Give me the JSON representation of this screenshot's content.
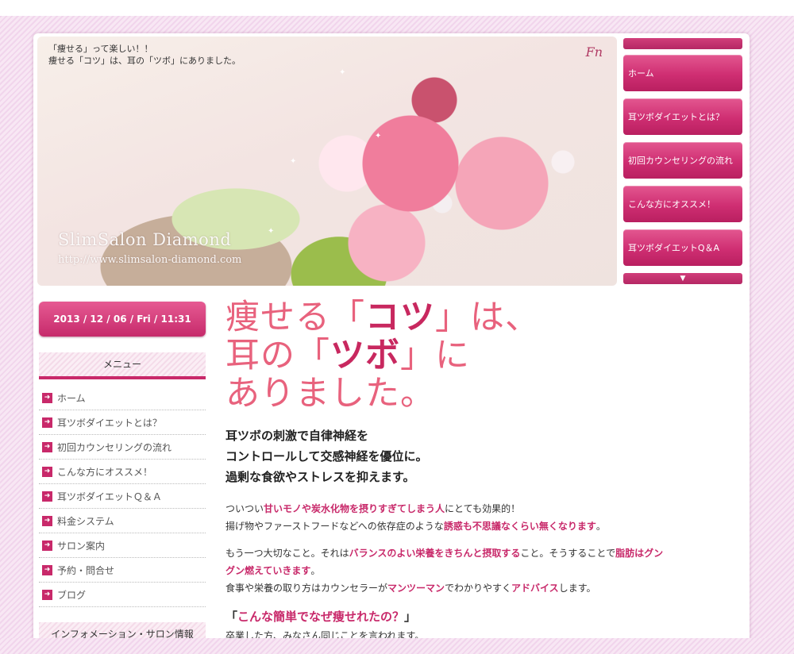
{
  "header": {
    "caption_line1": "「痩せる」って楽しい！！",
    "caption_line2": "痩せる「コツ」は、耳の「ツボ」にありました。",
    "logo_text": "Fn",
    "site_name": "SlimSalon Diamond",
    "site_url": "http://www.slimsalon-diamond.com"
  },
  "right_nav": {
    "items": [
      {
        "label": "ホーム"
      },
      {
        "label": "耳ツボダイエットとは？"
      },
      {
        "label": "初回カウンセリングの流れ"
      },
      {
        "label": "こんな方にオススメ！"
      },
      {
        "label": "耳ツボダイエットQ＆A"
      }
    ],
    "more_arrow": "▼"
  },
  "sidebar": {
    "datetime": "2013 / 12 / 06 / Fri / 11:31",
    "menu_title": "メニュー",
    "menu_items": [
      {
        "label": "ホーム"
      },
      {
        "label": "耳ツボダイエットとは？"
      },
      {
        "label": "初回カウンセリングの流れ"
      },
      {
        "label": "こんな方にオススメ！"
      },
      {
        "label": "耳ツボダイエットＱ＆Ａ"
      },
      {
        "label": "料金システム"
      },
      {
        "label": "サロン案内"
      },
      {
        "label": "予約・問合せ"
      },
      {
        "label": "ブログ"
      }
    ],
    "info_title": "インフォメーション・サロン情報"
  },
  "main": {
    "hero": {
      "l1a": "痩せる「",
      "l1b": "コツ",
      "l1c": "」は、",
      "l2a": "耳の「",
      "l2b": "ツボ",
      "l2c": "」に",
      "l3": "ありました。"
    },
    "lead": {
      "l1": "耳ツボの刺激で自律神経を",
      "l2": "コントロールして交感神経を優位に。",
      "l3": "過剰な食欲やストレスを抑えます。"
    },
    "p1": {
      "a": "ついつい",
      "b": "甘いモノや炭水化物を摂りすぎてしまう人",
      "c": "にとても効果的！",
      "d": "揚げ物やファーストフードなどへの依存症のような",
      "e": "誘惑も不思議なくらい無くなります",
      "f": "。"
    },
    "p2": {
      "a": "もう一つ大切なこと。それは",
      "b": "バランスのよい栄養をきちんと摂取する",
      "c": "こと。そうすることで",
      "d": "脂肪はグン",
      "e": "グン燃えていきます",
      "f": "。",
      "g": "食事や栄養の取り方はカウンセラーが",
      "h": "マンツーマン",
      "i": "でわかりやすく",
      "j": "アドバイス",
      "k": "します。"
    },
    "sub": {
      "open": "「",
      "text": "こんな簡単でなぜ痩せれたの？",
      "close": "」"
    },
    "cut_text": "卒業した方、みなさん同じことを言われます。"
  }
}
